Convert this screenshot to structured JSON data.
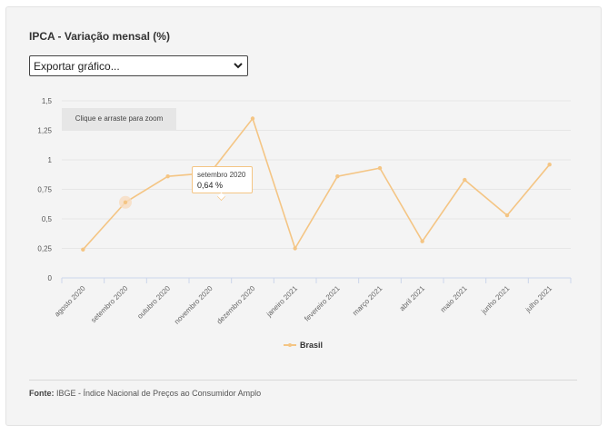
{
  "header": {
    "title": "IPCA - Variação mensal (%)"
  },
  "export_select": {
    "selected": "Exportar gráfico..."
  },
  "zoom_hint": "Clique e arraste para zoom",
  "tooltip": {
    "label": "setembro 2020",
    "value": "0,64 %"
  },
  "legend": {
    "label": "Brasil"
  },
  "source": {
    "label": "Fonte:",
    "text": "IBGE - Índice Nacional de Preços ao Consumidor Amplo"
  },
  "colors": {
    "series": "#f4c584",
    "hover_marker": "#f7dcc0"
  },
  "chart_data": {
    "type": "line",
    "title": "IPCA - Variação mensal (%)",
    "categories": [
      "agosto 2020",
      "setembro 2020",
      "outubro 2020",
      "novembro 2020",
      "dezembro 2020",
      "janeiro 2021",
      "fevereiro 2021",
      "março 2021",
      "abril 2021",
      "maio 2021",
      "junho 2021",
      "julho 2021"
    ],
    "series": [
      {
        "name": "Brasil",
        "values": [
          0.24,
          0.64,
          0.86,
          0.89,
          1.35,
          0.25,
          0.86,
          0.93,
          0.31,
          0.83,
          0.53,
          0.96
        ]
      }
    ],
    "y_ticks": [
      "0",
      "0,25",
      "0,5",
      "0,75",
      "1",
      "1,25",
      "1,5"
    ],
    "ylim": [
      0,
      1.5
    ],
    "grid": true,
    "legend_position": "bottom-center",
    "highlighted_index": 1
  }
}
